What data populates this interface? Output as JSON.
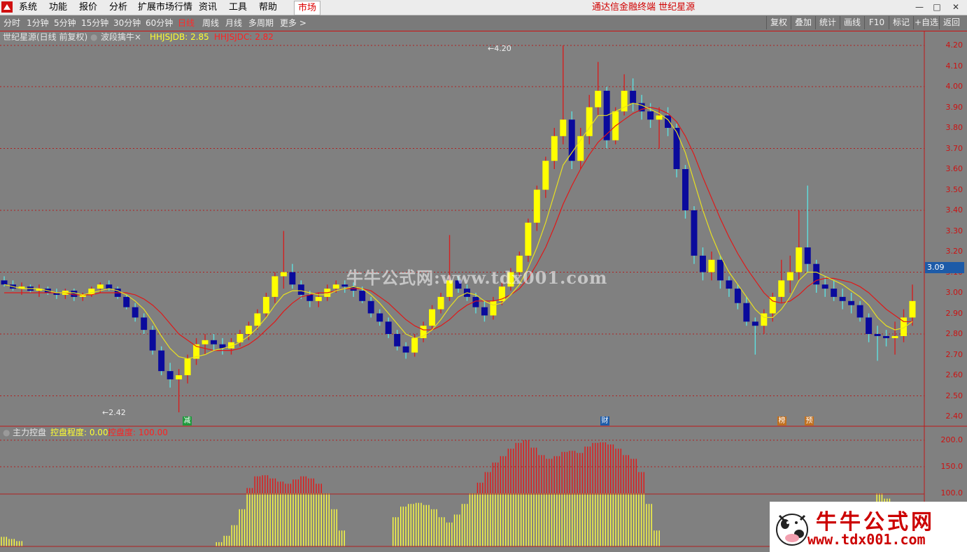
{
  "menu": {
    "items": [
      "系统",
      "功能",
      "报价",
      "分析",
      "扩展市场行情",
      "资讯",
      "工具",
      "帮助"
    ],
    "market_button": "市场",
    "app_title": "通达信金融终端  世纪星源"
  },
  "periods": {
    "items": [
      "分时",
      "1分钟",
      "5分钟",
      "15分钟",
      "30分钟",
      "60分钟",
      "日线",
      "周线",
      "月线",
      "多周期",
      "更多 >"
    ],
    "active": "日线"
  },
  "toolbar": {
    "buttons": [
      "复权",
      "叠加",
      "统计",
      "画线",
      "F10",
      "标记",
      "+自选",
      "返回"
    ]
  },
  "main_legend": {
    "stock_title": "世纪星源(日线 前复权)",
    "indicator_name": "波段擒牛",
    "indicator_close": "×",
    "line1_label": "HHJSJDB: 2.85",
    "line2_label": "HHJSJDC: 2.82"
  },
  "price_axis": {
    "ticks": [
      "4.20",
      "4.10",
      "4.00",
      "3.90",
      "3.80",
      "3.70",
      "3.60",
      "3.50",
      "3.40",
      "3.30",
      "3.20",
      "3.10",
      "3.00",
      "2.90",
      "2.80",
      "2.70",
      "2.60",
      "2.50",
      "2.40"
    ],
    "current_price": "3.09"
  },
  "annotations": {
    "high": "4.20",
    "low": "2.42"
  },
  "event_markers": [
    {
      "label": "减",
      "color": "#1e9a3c"
    },
    {
      "label": "财",
      "color": "#1d5ba8"
    },
    {
      "label": "榜",
      "color": "#c07020"
    },
    {
      "label": "预",
      "color": "#c07020"
    }
  ],
  "sub_legend": {
    "name": "主力控盘",
    "line1_label": "控盘程度: 0.00",
    "line2_label": "控盘度: 100.00"
  },
  "sub_axis": {
    "ticks": [
      "200.0",
      "150.0",
      "100.0"
    ]
  },
  "watermark": "牛牛公式网:www.tdx001.com",
  "brand": {
    "title": "牛牛公式网",
    "url": "www.tdx001.com"
  },
  "colors": {
    "up_body": "#ffff00",
    "down_body": "#0a0a9c",
    "up_wick": "#d42020",
    "down_wick": "#5ee0e0",
    "ma_red": "#e01818",
    "ma_yellow": "#e8e020",
    "grid": "#b02020",
    "hist_red": "#e01818",
    "hist_yellow": "#ffff40"
  },
  "chart_data": {
    "type": "candlestick",
    "ylim": [
      2.38,
      4.24
    ],
    "candles_ohlc": [
      [
        3.06,
        3.08,
        3.03,
        3.04
      ],
      [
        3.04,
        3.06,
        3.01,
        3.02
      ],
      [
        3.02,
        3.05,
        2.99,
        3.03
      ],
      [
        3.03,
        3.04,
        3.0,
        3.01
      ],
      [
        3.01,
        3.04,
        2.98,
        3.02
      ],
      [
        3.02,
        3.03,
        2.99,
        3.0
      ],
      [
        3.0,
        3.02,
        2.97,
        2.99
      ],
      [
        2.99,
        3.02,
        2.97,
        3.01
      ],
      [
        3.01,
        3.02,
        2.96,
        2.98
      ],
      [
        2.98,
        3.0,
        2.96,
        2.99
      ],
      [
        2.99,
        3.03,
        2.98,
        3.02
      ],
      [
        3.02,
        3.05,
        3.0,
        3.04
      ],
      [
        3.04,
        3.06,
        3.01,
        3.02
      ],
      [
        3.02,
        3.03,
        2.97,
        2.98
      ],
      [
        2.98,
        2.99,
        2.92,
        2.93
      ],
      [
        2.93,
        2.95,
        2.86,
        2.88
      ],
      [
        2.88,
        2.9,
        2.8,
        2.82
      ],
      [
        2.82,
        2.84,
        2.7,
        2.72
      ],
      [
        2.72,
        2.74,
        2.6,
        2.62
      ],
      [
        2.62,
        2.66,
        2.54,
        2.58
      ],
      [
        2.58,
        2.63,
        2.42,
        2.6
      ],
      [
        2.6,
        2.7,
        2.56,
        2.68
      ],
      [
        2.68,
        2.78,
        2.65,
        2.75
      ],
      [
        2.75,
        2.8,
        2.7,
        2.77
      ],
      [
        2.77,
        2.8,
        2.72,
        2.75
      ],
      [
        2.75,
        2.78,
        2.7,
        2.73
      ],
      [
        2.73,
        2.78,
        2.7,
        2.76
      ],
      [
        2.76,
        2.82,
        2.74,
        2.8
      ],
      [
        2.8,
        2.86,
        2.77,
        2.84
      ],
      [
        2.84,
        2.92,
        2.82,
        2.9
      ],
      [
        2.9,
        3.0,
        2.88,
        2.98
      ],
      [
        2.98,
        3.1,
        2.95,
        3.08
      ],
      [
        3.08,
        3.3,
        3.02,
        3.1
      ],
      [
        3.1,
        3.14,
        3.02,
        3.04
      ],
      [
        3.04,
        3.06,
        2.97,
        2.99
      ],
      [
        2.99,
        3.01,
        2.93,
        2.96
      ],
      [
        2.96,
        3.0,
        2.93,
        2.98
      ],
      [
        2.98,
        3.04,
        2.96,
        3.02
      ],
      [
        3.02,
        3.06,
        3.0,
        3.04
      ],
      [
        3.04,
        3.06,
        3.0,
        3.03
      ],
      [
        3.03,
        3.05,
        2.98,
        3.01
      ],
      [
        3.01,
        3.03,
        2.95,
        2.96
      ],
      [
        2.96,
        2.98,
        2.88,
        2.9
      ],
      [
        2.9,
        2.92,
        2.84,
        2.86
      ],
      [
        2.86,
        2.88,
        2.78,
        2.8
      ],
      [
        2.8,
        2.82,
        2.72,
        2.74
      ],
      [
        2.74,
        2.76,
        2.68,
        2.71
      ],
      [
        2.71,
        2.8,
        2.69,
        2.78
      ],
      [
        2.78,
        2.86,
        2.76,
        2.84
      ],
      [
        2.84,
        2.94,
        2.82,
        2.92
      ],
      [
        2.92,
        3.0,
        2.9,
        2.98
      ],
      [
        2.98,
        3.28,
        2.96,
        3.06
      ],
      [
        3.06,
        3.08,
        3.0,
        3.02
      ],
      [
        3.02,
        3.04,
        2.96,
        2.98
      ],
      [
        2.98,
        3.0,
        2.9,
        2.93
      ],
      [
        2.93,
        2.96,
        2.86,
        2.89
      ],
      [
        2.89,
        2.98,
        2.87,
        2.96
      ],
      [
        2.96,
        3.05,
        2.94,
        3.03
      ],
      [
        3.03,
        3.12,
        3.01,
        3.1
      ],
      [
        3.1,
        3.2,
        3.08,
        3.18
      ],
      [
        3.18,
        3.36,
        3.15,
        3.34
      ],
      [
        3.34,
        3.52,
        3.3,
        3.5
      ],
      [
        3.5,
        3.66,
        3.46,
        3.64
      ],
      [
        3.64,
        3.8,
        3.6,
        3.76
      ],
      [
        3.76,
        4.2,
        3.72,
        3.84
      ],
      [
        3.84,
        3.88,
        3.6,
        3.64
      ],
      [
        3.64,
        3.8,
        3.6,
        3.76
      ],
      [
        3.76,
        3.96,
        3.72,
        3.9
      ],
      [
        3.9,
        4.12,
        3.86,
        3.98
      ],
      [
        3.98,
        4.0,
        3.7,
        3.74
      ],
      [
        3.74,
        3.9,
        3.72,
        3.88
      ],
      [
        3.88,
        4.06,
        3.86,
        3.98
      ],
      [
        3.98,
        4.04,
        3.88,
        3.92
      ],
      [
        3.92,
        3.96,
        3.84,
        3.88
      ],
      [
        3.88,
        3.92,
        3.8,
        3.84
      ],
      [
        3.84,
        3.9,
        3.7,
        3.86
      ],
      [
        3.86,
        3.9,
        3.76,
        3.8
      ],
      [
        3.8,
        3.82,
        3.56,
        3.6
      ],
      [
        3.6,
        3.62,
        3.36,
        3.4
      ],
      [
        3.4,
        3.42,
        3.14,
        3.18
      ],
      [
        3.18,
        3.22,
        3.06,
        3.1
      ],
      [
        3.1,
        3.2,
        3.06,
        3.16
      ],
      [
        3.16,
        3.18,
        3.02,
        3.06
      ],
      [
        3.06,
        3.08,
        2.98,
        3.02
      ],
      [
        3.02,
        3.04,
        2.92,
        2.95
      ],
      [
        2.95,
        2.98,
        2.84,
        2.86
      ],
      [
        2.86,
        2.88,
        2.7,
        2.84
      ],
      [
        2.84,
        2.92,
        2.8,
        2.9
      ],
      [
        2.9,
        3.0,
        2.86,
        2.98
      ],
      [
        2.98,
        3.16,
        2.95,
        3.06
      ],
      [
        3.06,
        3.18,
        3.0,
        3.1
      ],
      [
        3.1,
        3.4,
        3.06,
        3.22
      ],
      [
        3.22,
        3.52,
        3.1,
        3.14
      ],
      [
        3.14,
        3.16,
        3.0,
        3.04
      ],
      [
        3.04,
        3.08,
        2.98,
        3.02
      ],
      [
        3.02,
        3.06,
        2.96,
        2.98
      ],
      [
        2.98,
        3.02,
        2.92,
        2.96
      ],
      [
        2.96,
        3.0,
        2.9,
        2.94
      ],
      [
        2.94,
        2.96,
        2.86,
        2.88
      ],
      [
        2.88,
        2.9,
        2.76,
        2.8
      ],
      [
        2.8,
        2.84,
        2.67,
        2.79
      ],
      [
        2.79,
        2.82,
        2.74,
        2.78
      ],
      [
        2.78,
        2.86,
        2.7,
        2.79
      ],
      [
        2.79,
        2.92,
        2.76,
        2.88
      ],
      [
        2.88,
        3.04,
        2.84,
        2.96
      ]
    ],
    "ma_fast": [
      3.04,
      3.03,
      3.02,
      3.02,
      3.02,
      3.01,
      3.0,
      3.0,
      3.0,
      2.99,
      3.0,
      3.01,
      3.02,
      3.01,
      2.99,
      2.96,
      2.92,
      2.86,
      2.79,
      2.73,
      2.69,
      2.68,
      2.69,
      2.7,
      2.72,
      2.73,
      2.74,
      2.76,
      2.79,
      2.83,
      2.88,
      2.94,
      2.99,
      3.01,
      3.01,
      3.0,
      2.99,
      2.99,
      3.01,
      3.02,
      3.03,
      3.02,
      2.99,
      2.95,
      2.9,
      2.85,
      2.8,
      2.78,
      2.79,
      2.82,
      2.87,
      2.93,
      2.98,
      3.0,
      2.99,
      2.96,
      2.94,
      2.95,
      2.99,
      3.04,
      3.12,
      3.22,
      3.34,
      3.48,
      3.62,
      3.68,
      3.74,
      3.8,
      3.86,
      3.86,
      3.88,
      3.9,
      3.92,
      3.91,
      3.89,
      3.87,
      3.84,
      3.78,
      3.68,
      3.54,
      3.4,
      3.28,
      3.18,
      3.1,
      3.04,
      2.98,
      2.92,
      2.88,
      2.88,
      2.92,
      2.98,
      3.06,
      3.1,
      3.1,
      3.08,
      3.06,
      3.04,
      3.01,
      2.98,
      2.94,
      2.88,
      2.84,
      2.82,
      2.83,
      2.86
    ],
    "ma_slow": [
      3.0,
      3.0,
      3.0,
      3.0,
      3.0,
      3.0,
      3.0,
      3.0,
      2.99,
      2.99,
      2.99,
      3.0,
      3.0,
      3.0,
      3.0,
      2.99,
      2.97,
      2.94,
      2.9,
      2.85,
      2.8,
      2.77,
      2.74,
      2.73,
      2.72,
      2.72,
      2.72,
      2.73,
      2.75,
      2.78,
      2.82,
      2.86,
      2.91,
      2.95,
      2.98,
      2.99,
      3.0,
      3.0,
      3.01,
      3.02,
      3.02,
      3.02,
      3.01,
      2.98,
      2.95,
      2.91,
      2.87,
      2.84,
      2.82,
      2.82,
      2.84,
      2.87,
      2.91,
      2.94,
      2.96,
      2.96,
      2.96,
      2.97,
      2.99,
      3.02,
      3.07,
      3.14,
      3.22,
      3.32,
      3.43,
      3.52,
      3.6,
      3.67,
      3.73,
      3.77,
      3.81,
      3.84,
      3.87,
      3.89,
      3.9,
      3.89,
      3.87,
      3.83,
      3.76,
      3.67,
      3.56,
      3.46,
      3.36,
      3.27,
      3.19,
      3.12,
      3.06,
      3.0,
      2.96,
      2.95,
      2.96,
      2.99,
      3.03,
      3.06,
      3.07,
      3.07,
      3.06,
      3.05,
      3.03,
      3.0,
      2.96,
      2.92,
      2.89,
      2.86,
      2.86
    ],
    "sub_values": [
      18,
      14,
      10,
      0,
      0,
      0,
      0,
      0,
      0,
      0,
      0,
      0,
      0,
      0,
      0,
      0,
      0,
      0,
      0,
      0,
      0,
      0,
      0,
      0,
      0,
      0,
      0,
      0,
      8,
      20,
      40,
      70,
      110,
      132,
      134,
      128,
      122,
      118,
      126,
      132,
      128,
      118,
      100,
      70,
      30,
      0,
      0,
      0,
      0,
      0,
      0,
      55,
      75,
      80,
      82,
      78,
      70,
      55,
      45,
      60,
      80,
      100,
      120,
      140,
      158,
      170,
      184,
      195,
      200,
      186,
      172,
      165,
      170,
      178,
      180,
      176,
      188,
      195,
      196,
      192,
      184,
      172,
      165,
      140,
      80,
      30,
      0,
      0,
      0,
      0,
      0,
      0,
      0,
      0,
      0,
      0,
      0,
      0,
      0,
      0,
      0,
      0,
      0,
      0,
      0,
      0,
      0,
      0,
      0,
      0,
      0,
      40,
      60,
      80,
      100,
      90,
      70,
      50,
      30,
      10
    ],
    "sub_ylim": [
      0,
      210
    ]
  }
}
